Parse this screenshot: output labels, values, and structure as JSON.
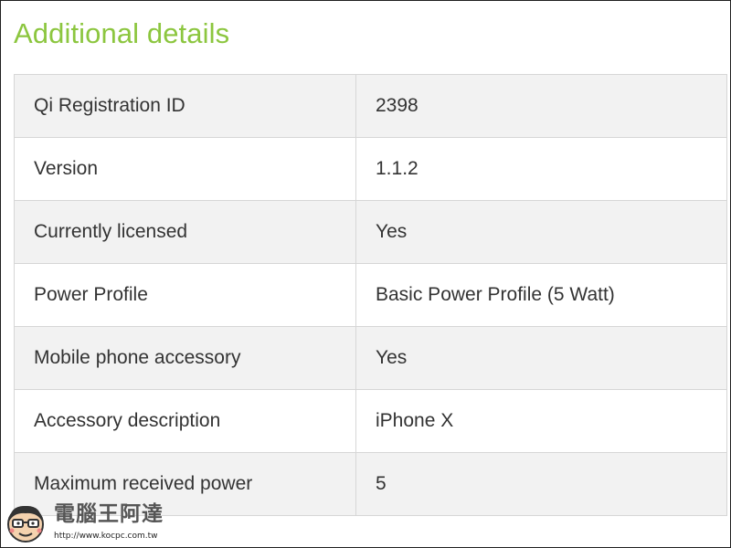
{
  "colors": {
    "title": "#8cc63f",
    "row_shaded": "#f2f2f2",
    "row_plain": "#ffffff",
    "cell_border": "#d6d6d6",
    "text": "#333333"
  },
  "section": {
    "title": "Additional details"
  },
  "details": [
    {
      "label": "Qi Registration ID",
      "value": "2398"
    },
    {
      "label": "Version",
      "value": "1.1.2"
    },
    {
      "label": "Currently licensed",
      "value": "Yes"
    },
    {
      "label": "Power Profile",
      "value": "Basic Power Profile (5 Watt)"
    },
    {
      "label": "Mobile phone accessory",
      "value": "Yes"
    },
    {
      "label": "Accessory description",
      "value": "iPhone X"
    },
    {
      "label": "Maximum received power",
      "value": "5"
    }
  ],
  "watermark": {
    "brand": "電腦王阿達",
    "url": "http://www.kocpc.com.tw",
    "icon": "mascot-icon"
  }
}
